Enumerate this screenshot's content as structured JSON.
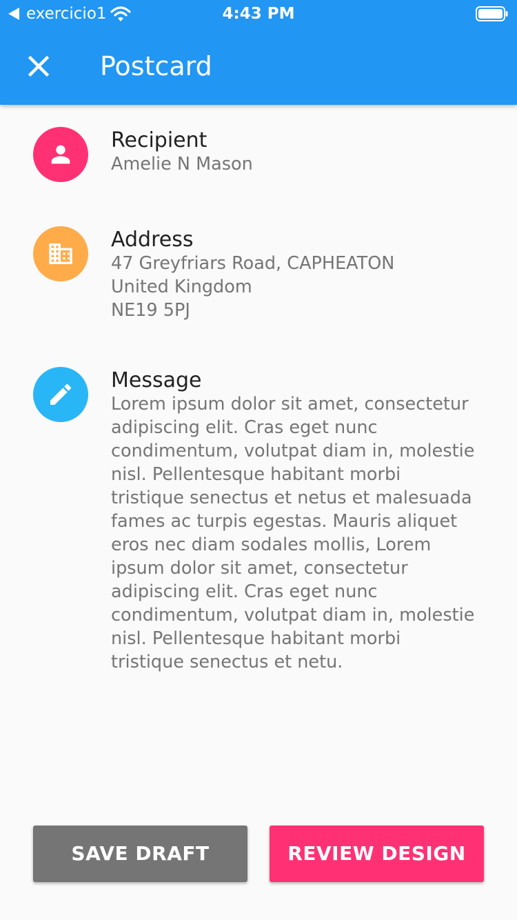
{
  "status_bar": {
    "carrier": "exercicio1",
    "time": "4:43 PM"
  },
  "app_bar": {
    "title": "Postcard",
    "close_icon": "close-icon"
  },
  "colors": {
    "app_bar": "#2196f3",
    "recipient_icon_bg": "#ff3174",
    "address_icon_bg": "#ffab4a",
    "message_icon_bg": "#29b6f6",
    "save_button": "#757575",
    "review_button": "#ff3174"
  },
  "recipient": {
    "icon": "person-icon",
    "title": "Recipient",
    "lines": [
      "Amelie N Mason"
    ]
  },
  "address": {
    "icon": "building-icon",
    "title": "Address",
    "lines": [
      "47 Greyfriars Road, CAPHEATON",
      "United Kingdom",
      "NE19 5PJ"
    ]
  },
  "message": {
    "icon": "pencil-icon",
    "title": "Message",
    "lines": [
      "Lorem ipsum dolor sit amet, consectetur",
      "adipiscing elit. Cras eget nunc",
      "condimentum, volutpat diam in, molestie",
      "nisl. Pellentesque habitant morbi",
      "tristique senectus et netus et malesuada",
      "fames ac turpis egestas. Mauris aliquet",
      "eros nec diam sodales mollis,  Lorem",
      "ipsum dolor sit amet, consectetur",
      "adipiscing elit. Cras eget nunc",
      "condimentum, volutpat diam in, molestie",
      "nisl. Pellentesque habitant morbi",
      "tristique senectus et netu."
    ]
  },
  "buttons": {
    "save_draft": "SAVE DRAFT",
    "review_design": "REVIEW DESIGN"
  }
}
